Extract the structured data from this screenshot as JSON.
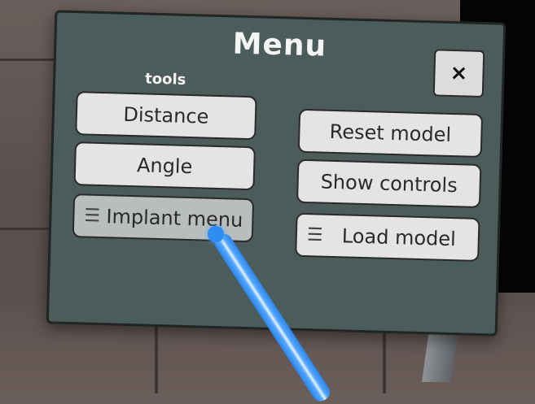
{
  "menu": {
    "title": "Menu",
    "close_label": "×",
    "tools_label": "tools",
    "left_buttons": [
      {
        "label": "Distance"
      },
      {
        "label": "Angle"
      },
      {
        "label": "Implant menu",
        "icon": "hamburger-icon"
      }
    ],
    "right_buttons": [
      {
        "label": "Reset model"
      },
      {
        "label": "Show controls"
      },
      {
        "label": "Load model",
        "icon": "hamburger-icon"
      }
    ]
  },
  "colors": {
    "panel": "#4c5c5a",
    "button": "#e4e4e4",
    "pointer": "#2f8df0"
  }
}
